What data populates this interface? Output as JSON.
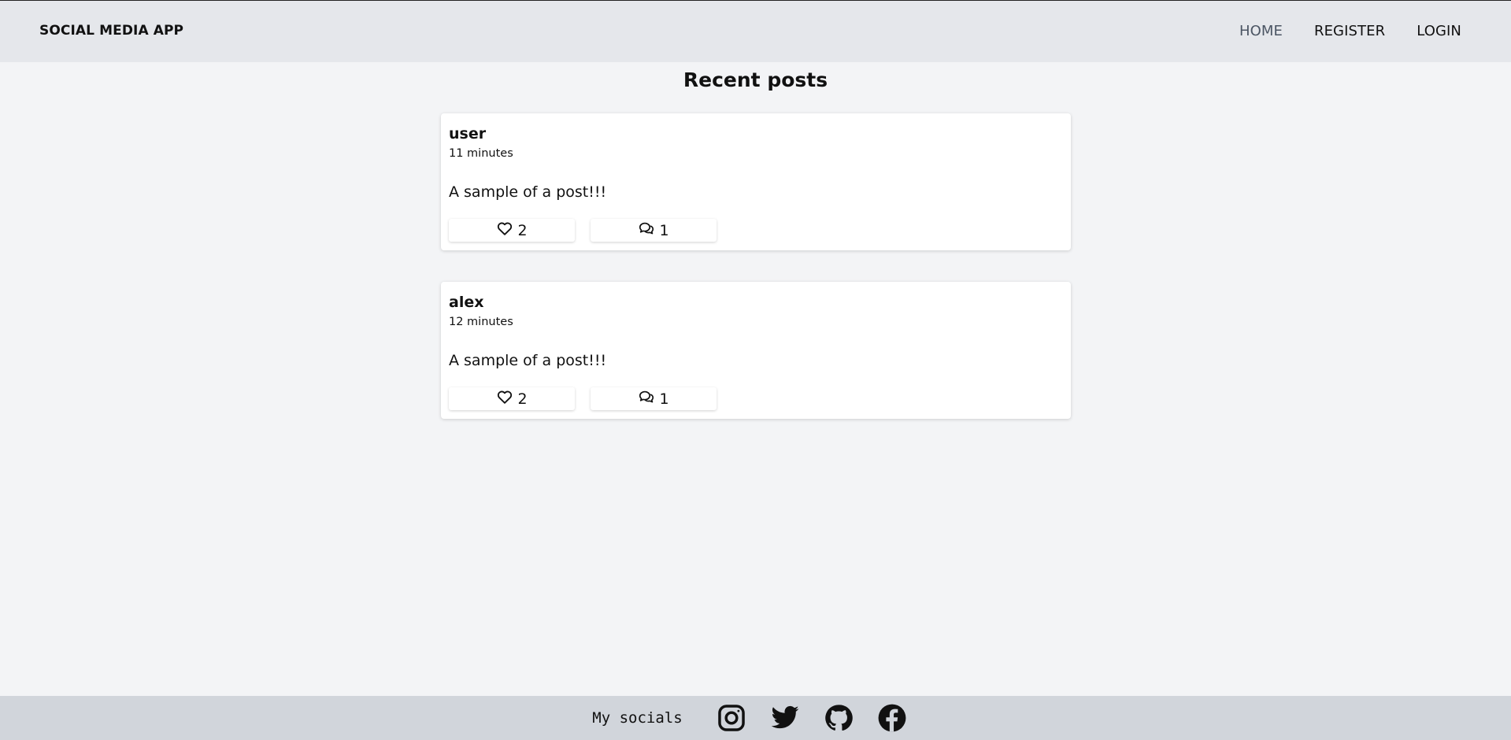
{
  "nav": {
    "brand": "SOCIAL MEDIA APP",
    "links": [
      {
        "label": "HOME"
      },
      {
        "label": "REGISTER"
      },
      {
        "label": "LOGIN"
      }
    ]
  },
  "page": {
    "title": "Recent posts"
  },
  "posts": [
    {
      "author": "user",
      "time": "11 minutes",
      "body": "A sample of a post!!!",
      "likes": "2",
      "comments": "1"
    },
    {
      "author": "alex",
      "time": "12 minutes",
      "body": "A sample of a post!!!",
      "likes": "2",
      "comments": "1"
    }
  ],
  "footer": {
    "label": "My socials",
    "icons": [
      "instagram-icon",
      "twitter-icon",
      "github-icon",
      "facebook-icon"
    ]
  },
  "colors": {
    "page_bg": "#f3f4f6",
    "navbar_bg": "#e5e7eb",
    "footer_bg": "#d1d5db",
    "active_link": "#4b5563"
  }
}
